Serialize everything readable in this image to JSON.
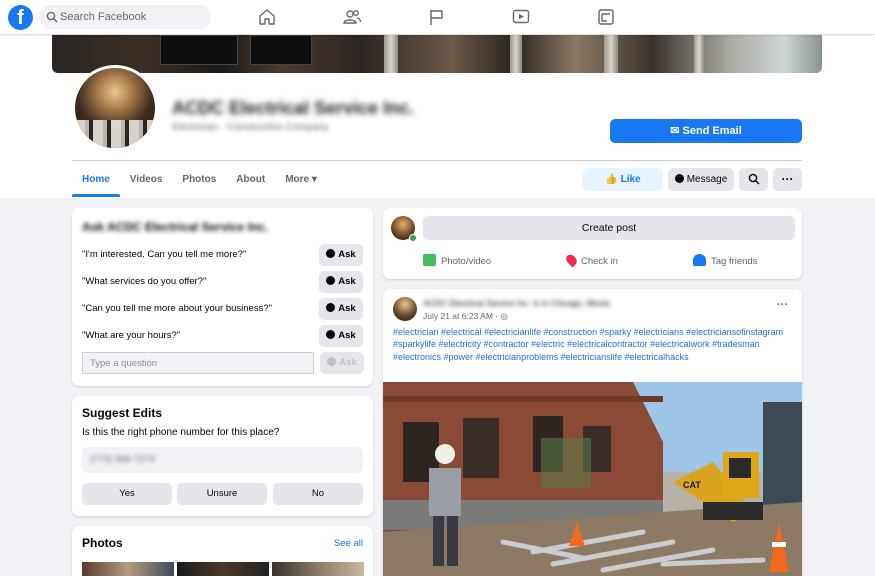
{
  "top_nav": {
    "search_placeholder": "Search Facebook",
    "logo_glyph": "f",
    "icons": [
      "home-icon",
      "friends-icon",
      "pages-flag-icon",
      "watch-icon",
      "gaming-icon"
    ]
  },
  "page": {
    "name": "ACDC Electrical Service Inc.",
    "category": "Electrician · Construction Company",
    "send_email_label": "Send Email"
  },
  "tabs": [
    {
      "label": "Home"
    },
    {
      "label": "Videos"
    },
    {
      "label": "Photos"
    },
    {
      "label": "About"
    },
    {
      "label": "More ▾"
    }
  ],
  "actions": {
    "like_label": "Like",
    "message_label": "Message",
    "more_label": "···"
  },
  "ask_card": {
    "title": "Ask ACDC Electrical Service Inc.",
    "questions": [
      "\"I'm interested. Can you tell me more?\"",
      "\"What services do you offer?\"",
      "\"Can you tell me more about your business?\"",
      "\"What are your hours?\""
    ],
    "ask_label": "Ask",
    "input_placeholder": "Type a question"
  },
  "suggest_edits": {
    "title": "Suggest Edits",
    "question": "Is this the right phone number for this place?",
    "phone": "(773) 966-7274",
    "buttons": [
      "Yes",
      "Unsure",
      "No"
    ]
  },
  "photos_card": {
    "title": "Photos",
    "see_all": "See all"
  },
  "create_post": {
    "label": "Create post",
    "actions": [
      "Photo/video",
      "Check in",
      "Tag friends"
    ]
  },
  "post": {
    "author_line": "ACDC Electrical Service Inc. is in Chicago, Illinois.",
    "time": "July 21 at 6:23 AM · ",
    "more": "···",
    "hashtags": "#electrician #electrical #electricianlife #construction #sparky #electricians #electriciansofinstagram #sparkylife #electricity #contractor  #electric #electricalcontractor #electricalwork #tradesman #electronics #power #electricianproblems #electricianslife #electricalhacks",
    "image_text": "CAT"
  },
  "colors": {
    "brand": "#1877f2",
    "background": "#f0f2f5",
    "button_gray": "#e4e6eb",
    "online_green": "#31a24c"
  }
}
